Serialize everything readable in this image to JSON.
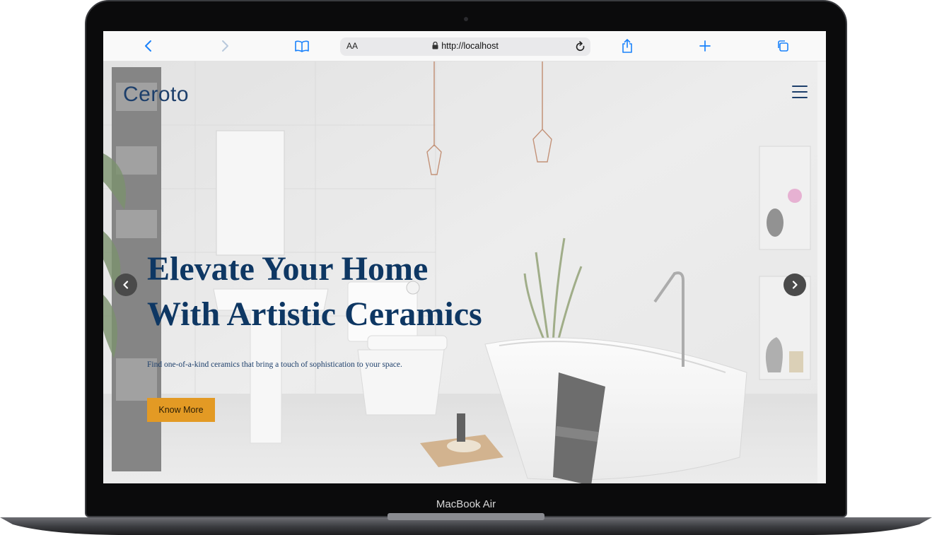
{
  "device": {
    "label": "MacBook Air"
  },
  "browser": {
    "text_size_label": "AA",
    "url": "http://localhost",
    "icons": [
      "back-icon",
      "forward-icon",
      "bookmarks-icon",
      "lock-icon",
      "reload-icon",
      "share-icon",
      "new-tab-icon",
      "tabs-icon"
    ]
  },
  "site": {
    "logo": "Ceroto",
    "headline_line1": "Elevate Your Home",
    "headline_line2": "With Artistic Ceramics",
    "subtitle": "Find one-of-a-kind ceramics that bring a touch of sophistication to your space.",
    "cta_label": "Know More",
    "colors": {
      "brand": "#0e3763",
      "accent": "#e39a24",
      "browser_blue": "#1a82fb"
    }
  }
}
